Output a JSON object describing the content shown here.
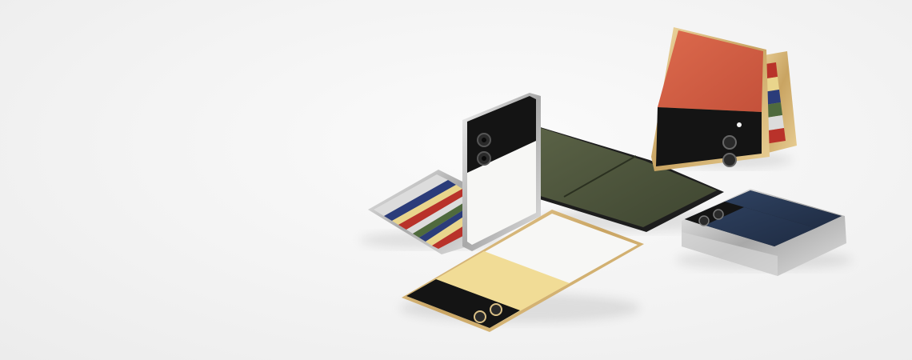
{
  "scene": {
    "subject": "foldable-phones-lineup",
    "colors": {
      "background": "#f3f3f3",
      "gold_frame": "#d8b878",
      "silver_frame": "#c9c9c9",
      "black_frame": "#2a2a2a",
      "orange_panel": "#d45a40",
      "khaki_panel": "#4b5238",
      "cream_panel": "#f1dc96",
      "white_panel": "#f7f7f5",
      "navy_panel": "#2a3a55",
      "black_panel": "#141414",
      "stripe_colors": [
        "#b9322a",
        "#e9d58c",
        "#2b3c7a",
        "#4f6a3d",
        "#dcdcdc",
        "#8a8a8a"
      ]
    }
  }
}
